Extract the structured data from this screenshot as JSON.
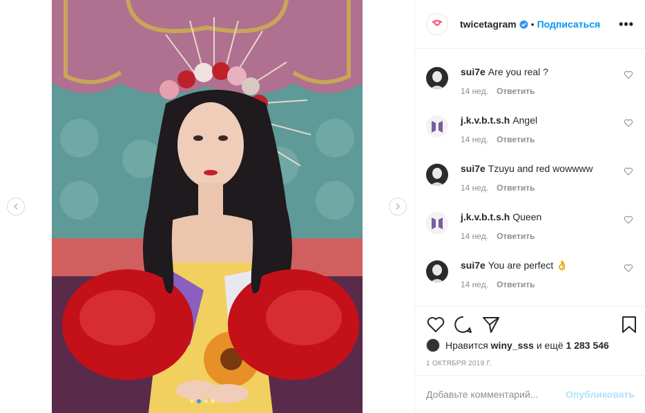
{
  "post": {
    "account": "twicetagram",
    "follow_label": "Подписаться",
    "separator": "•",
    "more_label": "•••",
    "likes_prefix": "Нравится",
    "likes_user": "winy_sss",
    "likes_mid": "и ещё",
    "likes_count": "1 283 546",
    "date": "1 ОКТЯБРЯ 2019 Г.",
    "comment_placeholder": "Добавьте комментарий...",
    "publish_label": "Опубликовать"
  },
  "comments": [
    {
      "user": "sui7e",
      "text": "Are you real ?",
      "age": "14 нед.",
      "reply": "Ответить",
      "avatar": "portrait"
    },
    {
      "user": "j.k.v.b.t.s.h",
      "text": "Angel",
      "age": "14 нед.",
      "reply": "Ответить",
      "avatar": "bts-logo"
    },
    {
      "user": "sui7e",
      "text": "Tzuyu and red wowwww",
      "age": "14 нед.",
      "reply": "Ответить",
      "avatar": "portrait"
    },
    {
      "user": "j.k.v.b.t.s.h",
      "text": "Queen",
      "age": "14 нед.",
      "reply": "Ответить",
      "avatar": "bts-logo"
    },
    {
      "user": "sui7e",
      "text": "You are perfect 👌",
      "age": "14 нед.",
      "reply": "Ответить",
      "avatar": "portrait"
    }
  ],
  "carousel": {
    "slide_count": 4,
    "active_slide": 1
  },
  "colors": {
    "link_blue": "#0095f6",
    "publish_disabled": "#b2dffc",
    "verified_blue": "#3897f0",
    "muted": "#8e8e8e"
  },
  "icons": [
    "chevron-left-icon",
    "chevron-right-icon",
    "verified-badge-icon",
    "heart-icon",
    "comment-icon",
    "share-icon",
    "bookmark-icon"
  ]
}
